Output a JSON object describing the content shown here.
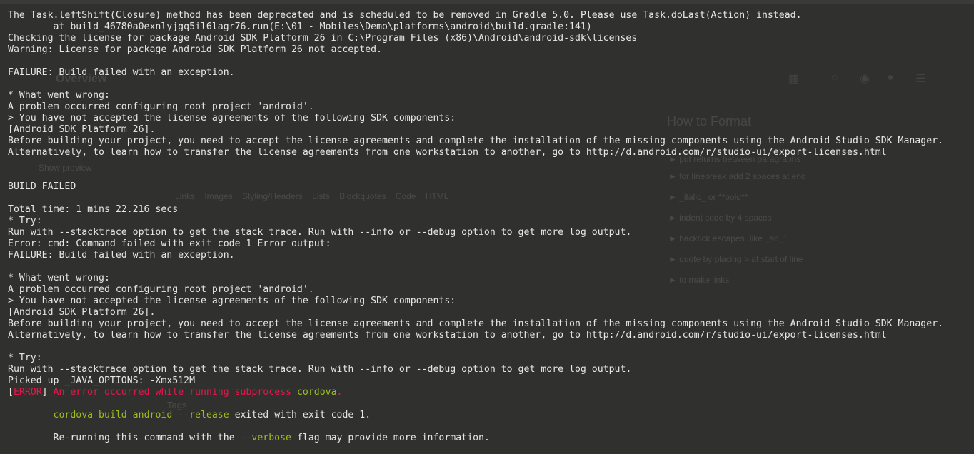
{
  "background_page": {
    "heading": "Overview",
    "right_heading": "How to Format",
    "left_link": "Show preview",
    "toolbar_tabs": "Links Images Styling/Headers Lists Blockquotes Code HTML",
    "tags_label": "Tags",
    "hints": [
      "► put returns between paragraphs",
      "► for linebreak add 2 spaces at end",
      "► _italic_ or **bold**",
      "► indent code by 4 spaces",
      "► backtick escapes `like _so_`",
      "► quote by placing > at start of line",
      "► to make links"
    ]
  },
  "console": {
    "lines": [
      {
        "segments": [
          {
            "text": "The Task.leftShift(Closure) method has been deprecated and is scheduled to be removed in Gradle 5.0. Please use Task.doLast(Action) instead.",
            "color": "white"
          }
        ]
      },
      {
        "segments": [
          {
            "text": "        at build_46780a0exnlyjgq5il6lagr76.run(E:\\01 - Mobiles\\Demo\\platforms\\android\\build.gradle:141)",
            "color": "white"
          }
        ]
      },
      {
        "segments": [
          {
            "text": "Checking the license for package Android SDK Platform 26 in C:\\Program Files (x86)\\Android\\android-sdk\\licenses",
            "color": "white"
          }
        ]
      },
      {
        "segments": [
          {
            "text": "Warning: License for package Android SDK Platform 26 not accepted.",
            "color": "white"
          }
        ]
      },
      {
        "segments": [
          {
            "text": "",
            "color": "white"
          }
        ]
      },
      {
        "segments": [
          {
            "text": "FAILURE: Build failed with an exception.",
            "color": "white"
          }
        ]
      },
      {
        "segments": [
          {
            "text": "",
            "color": "white"
          }
        ]
      },
      {
        "segments": [
          {
            "text": "* What went wrong:",
            "color": "white"
          }
        ]
      },
      {
        "segments": [
          {
            "text": "A problem occurred configuring root project 'android'.",
            "color": "white"
          }
        ]
      },
      {
        "segments": [
          {
            "text": "> You have not accepted the license agreements of the following SDK components:",
            "color": "white"
          }
        ]
      },
      {
        "segments": [
          {
            "text": "[Android SDK Platform 26].",
            "color": "white"
          }
        ]
      },
      {
        "segments": [
          {
            "text": "Before building your project, you need to accept the license agreements and complete the installation of the missing components using the Android Studio SDK Manager.",
            "color": "white"
          }
        ]
      },
      {
        "segments": [
          {
            "text": "Alternatively, to learn how to transfer the license agreements from one workstation to another, go to http://d.android.com/r/studio-ui/export-licenses.html",
            "color": "white"
          }
        ]
      },
      {
        "segments": [
          {
            "text": "",
            "color": "white"
          }
        ]
      },
      {
        "segments": [
          {
            "text": "",
            "color": "white"
          }
        ]
      },
      {
        "segments": [
          {
            "text": "BUILD FAILED",
            "color": "white"
          }
        ]
      },
      {
        "segments": [
          {
            "text": "",
            "color": "white"
          }
        ]
      },
      {
        "segments": [
          {
            "text": "Total time: 1 mins 22.216 secs",
            "color": "white"
          }
        ]
      },
      {
        "segments": [
          {
            "text": "* Try:",
            "color": "white"
          }
        ]
      },
      {
        "segments": [
          {
            "text": "Run with --stacktrace option to get the stack trace. Run with --info or --debug option to get more log output.",
            "color": "white"
          }
        ]
      },
      {
        "segments": [
          {
            "text": "Error: cmd: Command failed with exit code 1 Error output:",
            "color": "white"
          }
        ]
      },
      {
        "segments": [
          {
            "text": "FAILURE: Build failed with an exception.",
            "color": "white"
          }
        ]
      },
      {
        "segments": [
          {
            "text": "",
            "color": "white"
          }
        ]
      },
      {
        "segments": [
          {
            "text": "* What went wrong:",
            "color": "white"
          }
        ]
      },
      {
        "segments": [
          {
            "text": "A problem occurred configuring root project 'android'.",
            "color": "white"
          }
        ]
      },
      {
        "segments": [
          {
            "text": "> You have not accepted the license agreements of the following SDK components:",
            "color": "white"
          }
        ]
      },
      {
        "segments": [
          {
            "text": "[Android SDK Platform 26].",
            "color": "white"
          }
        ]
      },
      {
        "segments": [
          {
            "text": "Before building your project, you need to accept the license agreements and complete the installation of the missing components using the Android Studio SDK Manager.",
            "color": "white"
          }
        ]
      },
      {
        "segments": [
          {
            "text": "Alternatively, to learn how to transfer the license agreements from one workstation to another, go to http://d.android.com/r/studio-ui/export-licenses.html",
            "color": "white"
          }
        ]
      },
      {
        "segments": [
          {
            "text": "",
            "color": "white"
          }
        ]
      },
      {
        "segments": [
          {
            "text": "* Try:",
            "color": "white"
          }
        ]
      },
      {
        "segments": [
          {
            "text": "Run with --stacktrace option to get the stack trace. Run with --info or --debug option to get more log output.",
            "color": "white"
          }
        ]
      },
      {
        "segments": [
          {
            "text": "Picked up _JAVA_OPTIONS: -Xmx512M",
            "color": "white"
          }
        ]
      },
      {
        "segments": [
          {
            "text": "[",
            "color": "white"
          },
          {
            "text": "ERROR",
            "color": "red"
          },
          {
            "text": "] ",
            "color": "white"
          },
          {
            "text": "An error occurred while running subprocess ",
            "color": "red"
          },
          {
            "text": "cordova",
            "color": "green"
          },
          {
            "text": ".",
            "color": "red"
          }
        ]
      },
      {
        "segments": [
          {
            "text": "",
            "color": "white"
          }
        ]
      },
      {
        "segments": [
          {
            "text": "        ",
            "color": "white"
          },
          {
            "text": "cordova build android --release",
            "color": "green"
          },
          {
            "text": " exited with exit code 1.",
            "color": "white"
          }
        ]
      },
      {
        "segments": [
          {
            "text": "",
            "color": "white"
          }
        ]
      },
      {
        "segments": [
          {
            "text": "        Re-running this command with the ",
            "color": "white"
          },
          {
            "text": "--verbose",
            "color": "green"
          },
          {
            "text": " flag may provide more information.",
            "color": "white"
          }
        ]
      }
    ]
  },
  "colors": {
    "background": "#30302f",
    "text": "#e6e6e2",
    "error_red": "#e8164d",
    "command_green": "#9bbd1e"
  }
}
